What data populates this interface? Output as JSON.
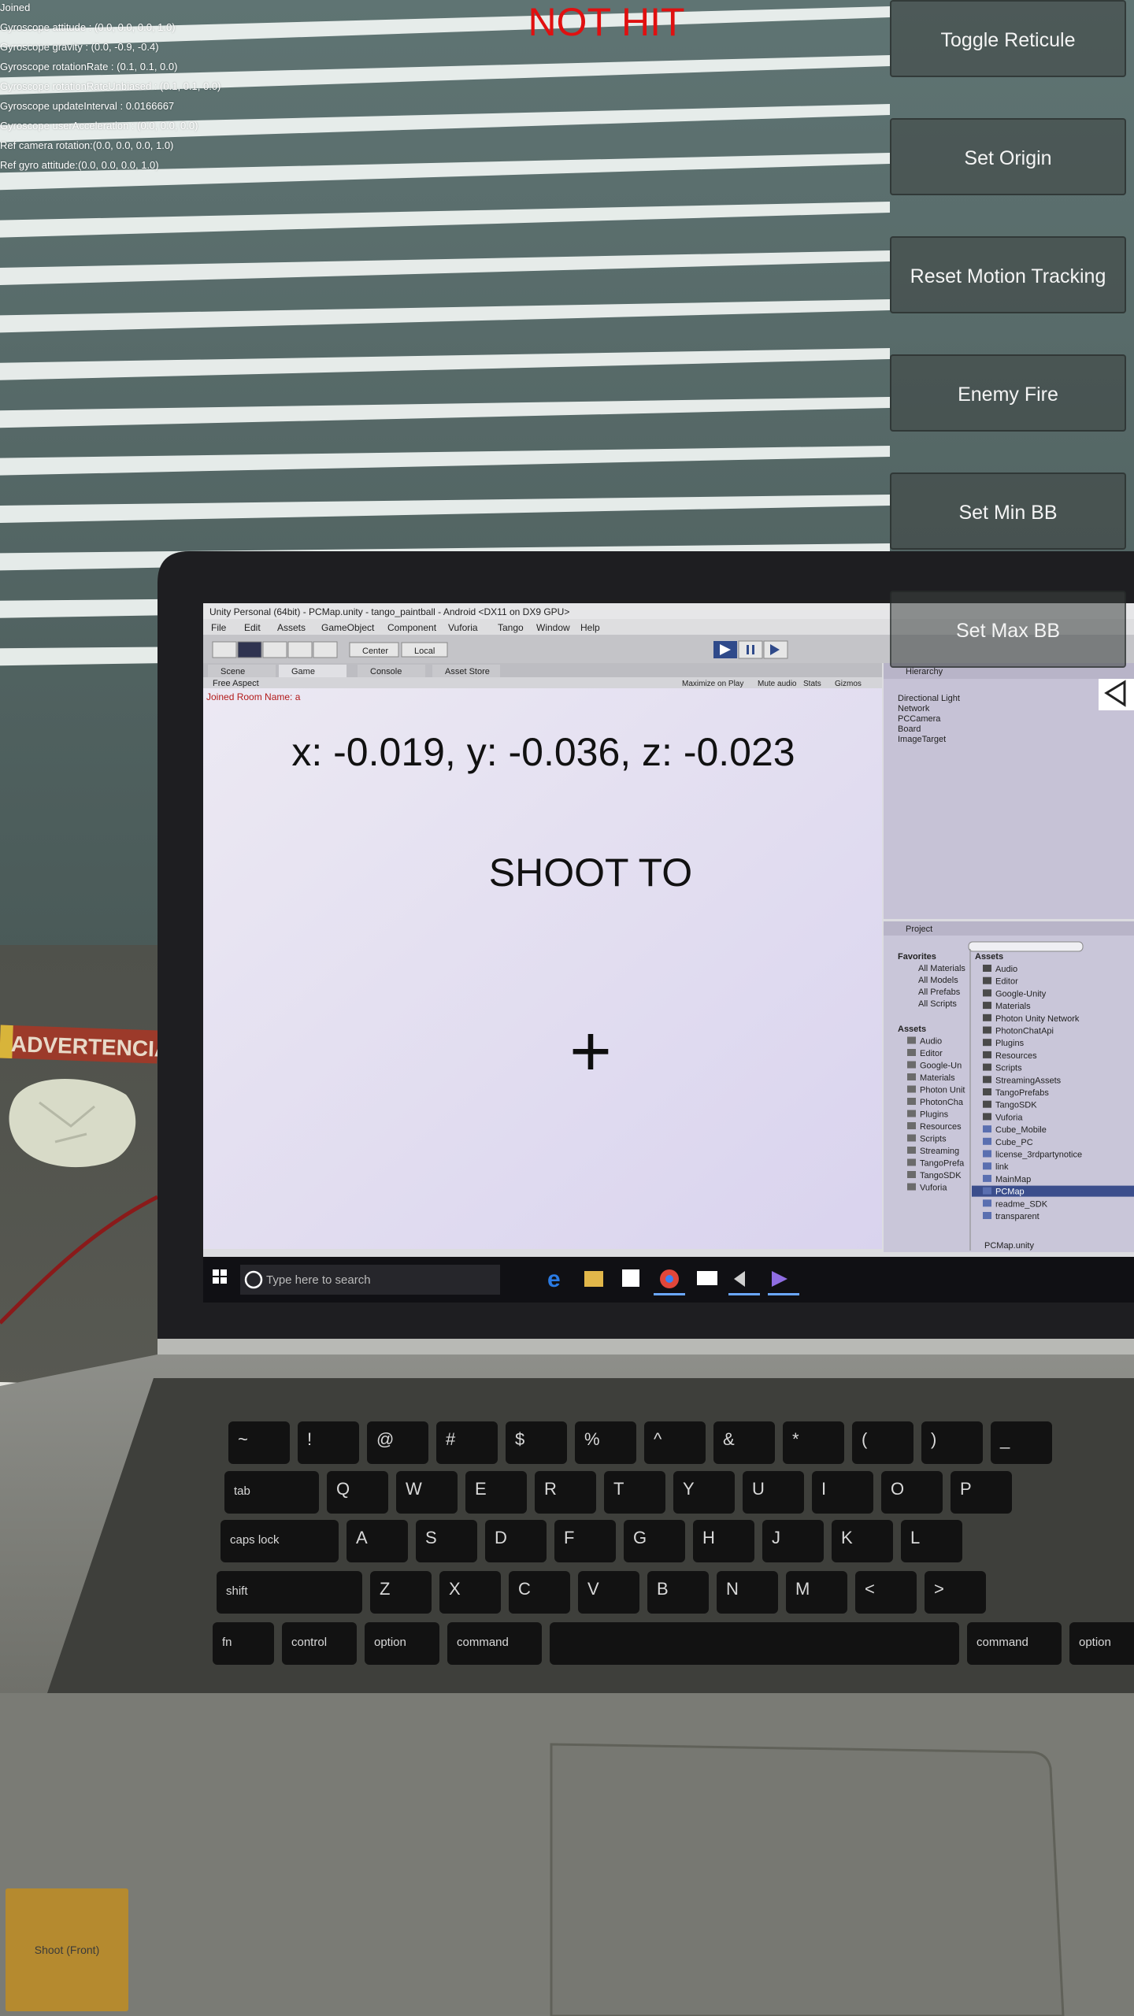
{
  "debug": {
    "lines": [
      "Joined",
      "Gyroscope attitude : (0.0, 0.0, 0.0, 1.0)",
      "Gyroscope gravity : (0.0, -0.9, -0.4)",
      "Gyroscope rotationRate : (0.1, 0.1, 0.0)",
      "Gyroscope rotationRateUnbiased : (0.1, 0.1, 0.0)",
      "Gyroscope updateInterval : 0.0166667",
      "Gyroscope userAcceleration : (0.0, 0.0, 0.0)",
      "Ref camera rotation:(0.0, 0.0, 0.0, 1.0)",
      "Ref gyro attitude:(0.0, 0.0, 0.0, 1.0)"
    ]
  },
  "hit_status": "NOT HIT",
  "buttons": {
    "toggle_reticule": "Toggle Reticule",
    "set_origin": "Set Origin",
    "reset_motion_tracking": "Reset Motion Tracking",
    "enemy_fire": "Enemy Fire",
    "set_min_bb": "Set Min BB",
    "set_max_bb": "Set Max BB",
    "shoot_front": "Shoot (Front)"
  },
  "coords": "x: -0.019, y: -0.036, z: -0.023",
  "shoot_to": "SHOOT TO",
  "reticule": "+",
  "camera_scene": {
    "warning_sign": "ADVERTENCIA",
    "laptop_screen": {
      "title_bar": "Unity Personal (64bit) - PCMap.unity - tango_paintball - Android <DX11 on DX9 GPU>",
      "menu": [
        "File",
        "Edit",
        "Assets",
        "GameObject",
        "Component",
        "Vuforia",
        "Tango",
        "Window",
        "Help"
      ],
      "tabs": [
        "Scene",
        "Game",
        "Console",
        "Asset Store"
      ],
      "toolbar_pivot": [
        "Center",
        "Local"
      ],
      "aspect": "Free Aspect",
      "game_options": [
        "Maximize on Play",
        "Mute audio",
        "Stats",
        "Gizmos"
      ],
      "game_log": "Joined Room Name: a",
      "hierarchy_title": "Hierarchy",
      "hierarchy_items": [
        "Directional Light",
        "Network",
        "PCCamera",
        "Board",
        "ImageTarget"
      ],
      "project_title": "Project",
      "favorites": [
        "Favorites",
        "All Materials",
        "All Models",
        "All Prefabs",
        "All Scripts"
      ],
      "assets_tree": [
        "Assets",
        "Audio",
        "Editor",
        "Google-Un",
        "Materials",
        "Photon Unit",
        "PhotonCha",
        "Plugins",
        "Resources",
        "Scripts",
        "Streaming",
        "TangoPrefa",
        "TangoSDK",
        "Vuforia"
      ],
      "assets_list": [
        "Audio",
        "Editor",
        "Google-Unity",
        "Materials",
        "Photon Unity Network",
        "PhotonChatApi",
        "Plugins",
        "Resources",
        "Scripts",
        "StreamingAssets",
        "TangoPrefabs",
        "TangoSDK",
        "Vuforia",
        "Cube_Mobile",
        "Cube_PC",
        "license_3rdpartynotice",
        "link",
        "MainMap",
        "PCMap",
        "readme_SDK",
        "transparent"
      ],
      "assets_footer": "PCMap.unity",
      "taskbar_search": "Type here to search"
    },
    "keyboard_rows": [
      [
        "~",
        "!",
        "@",
        "#",
        "$",
        "%",
        "^",
        "&",
        "*",
        "(",
        ")",
        "_"
      ],
      [
        "tab",
        "Q",
        "W",
        "E",
        "R",
        "T",
        "Y",
        "U",
        "I",
        "O",
        "P"
      ],
      [
        "caps lock",
        "A",
        "S",
        "D",
        "F",
        "G",
        "H",
        "J",
        "K",
        "L"
      ],
      [
        "shift",
        "Z",
        "X",
        "C",
        "V",
        "B",
        "N",
        "M",
        "<",
        ">"
      ],
      [
        "fn",
        "control",
        "option",
        "command",
        "command",
        "option"
      ]
    ]
  }
}
